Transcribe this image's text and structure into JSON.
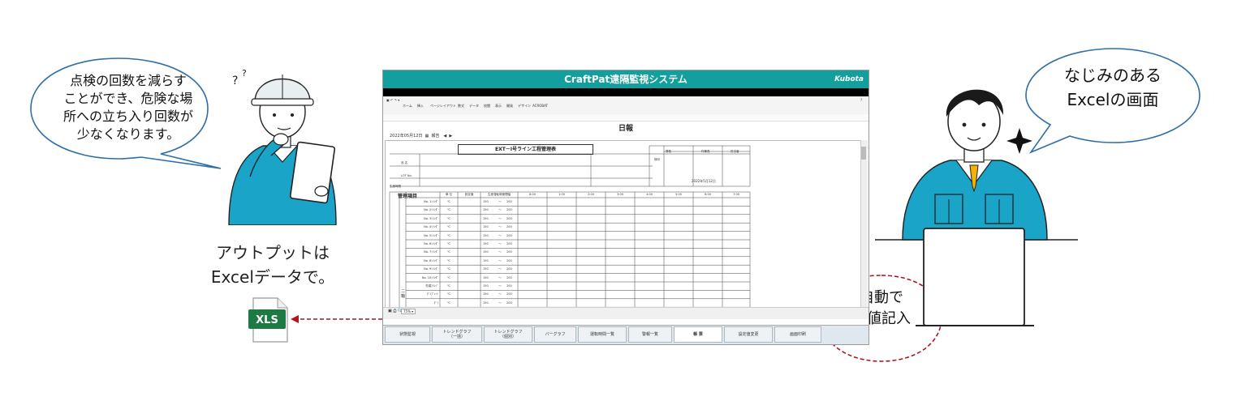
{
  "left_bubble": {
    "line1": "点検の回数を減らす",
    "line2": "ことができ、危険な場",
    "line3": "所への立ち入り回数が",
    "line4": "少なくなります。"
  },
  "right_bubble": {
    "line1": "なじみのある",
    "line2": "Excelの画面"
  },
  "output_caption": {
    "line1": "アウトプットは",
    "line2": "Excelデータで。"
  },
  "xls_icon": {
    "label": "XLS",
    "color": "#1e7a43"
  },
  "auto_bubble": {
    "line1": "自動で",
    "line2": "数値記入"
  },
  "app": {
    "title": "CraftPat遠隔監視システム",
    "brand": "Kubota",
    "title_color": "#129f9e",
    "ribbon_tabs": [
      "ホーム",
      "挿入",
      "ページレイアウト",
      "数式",
      "データ",
      "校閲",
      "表示",
      "開発",
      "デザイン",
      "ACROBAT"
    ],
    "sheet_title": "日報",
    "date_text": "2022年05月12日",
    "report_label": "報告",
    "report": {
      "title": "EXT－Ⅰ号ライン工程管理表",
      "fields": {
        "name": "品 名",
        "lot": "LOT No.",
        "product_date": "生産時間",
        "date_value": "2022年5月12日",
        "approver": "検印",
        "roles": [
          "課長",
          "作業長",
          "担当者"
        ]
      },
      "mgmt_label": "管理項目",
      "col_headers": [
        "単 位",
        "設定値",
        "生産運転時管理幅",
        "8:00",
        "1:00",
        "2:00",
        "3:00",
        "4:00",
        "5:00",
        "6:00",
        "7:00"
      ],
      "rows": [
        {
          "label": "No. 1ｼﾘﾝﾀﾞ",
          "unit": "℃",
          "lo": "150",
          "hi": "200"
        },
        {
          "label": "No. 2ｼﾘﾝﾀﾞ",
          "unit": "℃",
          "lo": "150",
          "hi": "200"
        },
        {
          "label": "No. 3ｼﾘﾝﾀﾞ",
          "unit": "℃",
          "lo": "150",
          "hi": "200"
        },
        {
          "label": "No. 4ｼﾘﾝﾀﾞ",
          "unit": "℃",
          "lo": "150",
          "hi": "200"
        },
        {
          "label": "No. 5ｼﾘﾝﾀﾞ",
          "unit": "℃",
          "lo": "150",
          "hi": "200"
        },
        {
          "label": "No. 6ｼﾘﾝﾀﾞ",
          "unit": "℃",
          "lo": "150",
          "hi": "200"
        },
        {
          "label": "No. 7ｼﾘﾝﾀﾞ",
          "unit": "℃",
          "lo": "150",
          "hi": "200"
        },
        {
          "label": "No. 8ｼﾘﾝﾀﾞ",
          "unit": "℃",
          "lo": "150",
          "hi": "200"
        },
        {
          "label": "No. 9ｼﾘﾝﾀﾞ",
          "unit": "℃",
          "lo": "150",
          "hi": "200"
        },
        {
          "label": "No. 10ｼﾘﾝﾀﾞ",
          "unit": "℃",
          "lo": "150",
          "hi": "200"
        },
        {
          "label": "先端ﾌﾗﾝｼﾞ",
          "unit": "℃",
          "lo": "150",
          "hi": "200"
        },
        {
          "label": "ﾀﾞｲﾌﾟﾚｰﾄ",
          "unit": "℃",
          "lo": "150",
          "hi": "200"
        },
        {
          "label": "ﾀﾞｲ",
          "unit": "℃",
          "lo": "150",
          "hi": "200"
        }
      ],
      "side_label": "二軸"
    },
    "zoom": "75%",
    "nav_tabs": [
      {
        "label": "状態監視",
        "active": false
      },
      {
        "label": "トレンドグラフ\n（一括）",
        "active": false
      },
      {
        "label": "トレンドグラフ\n（個別）",
        "active": false
      },
      {
        "label": "バーグラフ",
        "active": false
      },
      {
        "label": "運転時間一覧",
        "active": false
      },
      {
        "label": "警報一覧",
        "active": false
      },
      {
        "label": "帳 票",
        "active": true
      },
      {
        "label": "設定値変更",
        "active": false
      },
      {
        "label": "画面印刷",
        "active": false
      }
    ],
    "highlight_color": "#b0141c"
  }
}
